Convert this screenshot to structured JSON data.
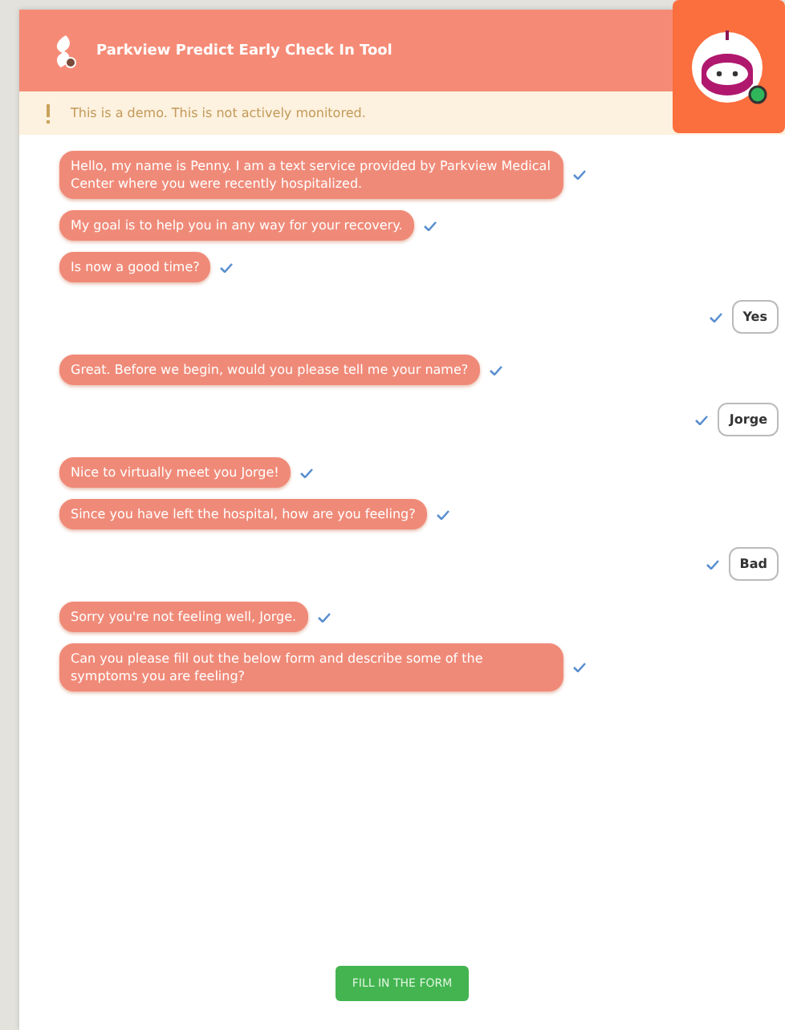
{
  "header": {
    "title": "Parkview Predict Early Check In Tool"
  },
  "notice": {
    "text": "This is a demo. This is not actively monitored."
  },
  "messages": [
    {
      "kind": "bot",
      "text": "Hello, my name is Penny. I am a text service provided by Parkview Medical Center where you were recently hospitalized."
    },
    {
      "kind": "bot",
      "text": "My goal is to help you in any way for your recovery."
    },
    {
      "kind": "bot",
      "text": "Is now a good time?"
    },
    {
      "kind": "user",
      "text": "Yes"
    },
    {
      "kind": "bot",
      "text": "Great. Before we begin, would you please tell me your name?"
    },
    {
      "kind": "user",
      "text": "Jorge"
    },
    {
      "kind": "bot",
      "text": "Nice to virtually meet you Jorge!"
    },
    {
      "kind": "bot",
      "text": "Since you have left the hospital, how are you feeling?"
    },
    {
      "kind": "user",
      "text": "Bad"
    },
    {
      "kind": "bot",
      "text": "Sorry you're not feeling well, Jorge."
    },
    {
      "kind": "bot",
      "text": "Can you please fill out the below form and describe some of the symptoms you are feeling?"
    }
  ],
  "action": {
    "label": "FILL IN THE FORM"
  }
}
